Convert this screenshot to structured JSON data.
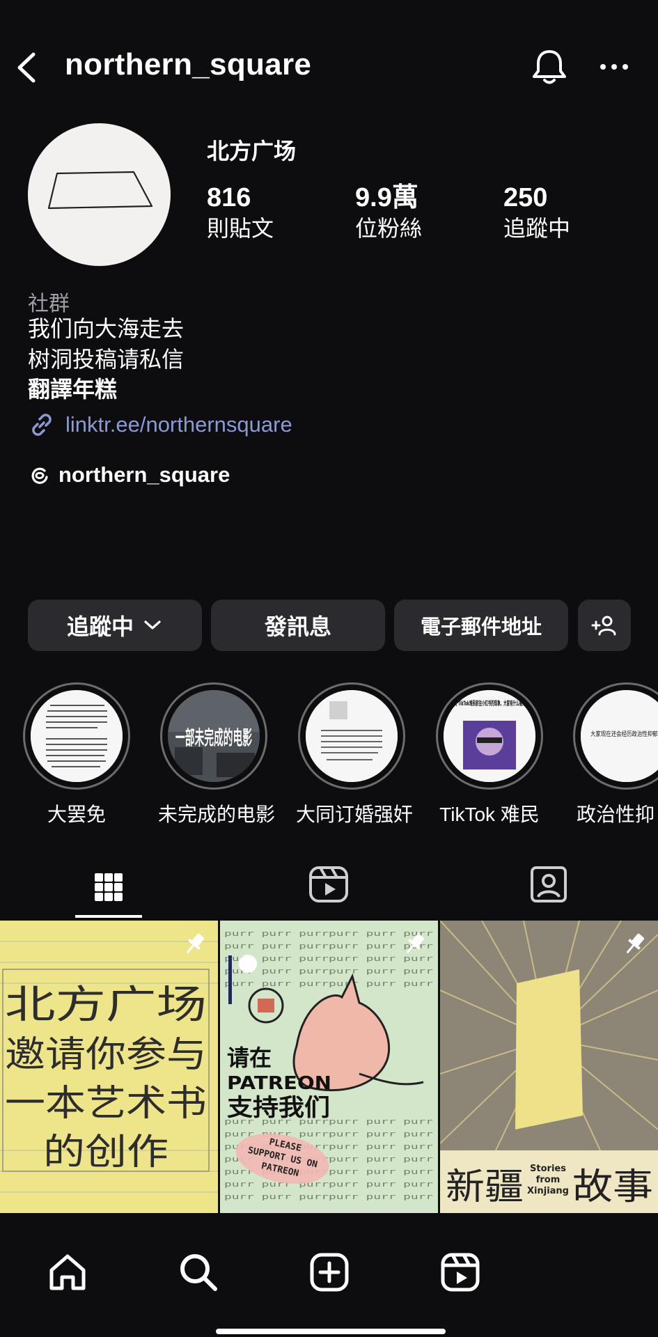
{
  "header": {
    "username": "northern_square"
  },
  "profile": {
    "display_name": "北方广场",
    "stats": [
      {
        "value": "816",
        "label": "則貼文"
      },
      {
        "value": "9.9萬",
        "label": "位粉絲"
      },
      {
        "value": "250",
        "label": "追蹤中"
      }
    ],
    "category": "社群",
    "bio_lines": [
      "我们向大海走去",
      "树洞投稿请私信",
      "翻譯年糕"
    ],
    "link": "linktr.ee/northernsquare",
    "threads_handle": "northern_square"
  },
  "actions": {
    "following_label": "追蹤中",
    "message_label": "發訊息",
    "email_label": "電子郵件地址"
  },
  "highlights": [
    {
      "label": "大罢免"
    },
    {
      "label": "未完成的电影"
    },
    {
      "label": "大同订婚强奸"
    },
    {
      "label": "TikTok 难民"
    },
    {
      "label": "政治性抑"
    }
  ],
  "highlight_cover_text": {
    "h2": "一部未完成的电影",
    "h4": "对于TikTok难民前往小红书的现象，大家有什么看法?",
    "h5": "大家现在还会经历政治性抑郁吗"
  },
  "posts": [
    {
      "lines": [
        "北方广场",
        "邀请你参与",
        "一本艺术书",
        "的创作"
      ],
      "pinned": true
    },
    {
      "title_lines": [
        "请在",
        "PATREON",
        "支持我们"
      ],
      "stamp_lines": [
        "PLEASE",
        "SUPPORT US ON",
        "PATREON"
      ],
      "background_word": "purr purr purrpurr purr purr",
      "pinned": true
    },
    {
      "title_left": "新疆",
      "title_right": "故事",
      "subtitle_lines": [
        "Stories",
        "from",
        "Xinjiang"
      ],
      "pinned": true
    }
  ],
  "colors": {
    "background": "#0d0d0f",
    "button": "#2b2b2f",
    "link": "#8b9ad3",
    "muted": "#9e9ea6"
  }
}
